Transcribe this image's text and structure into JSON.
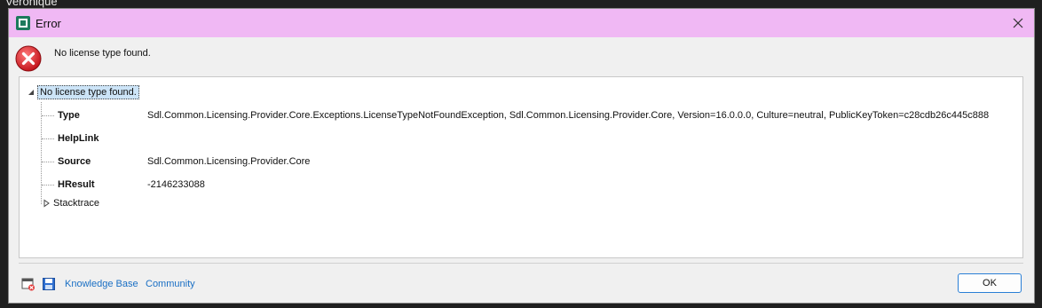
{
  "background": {
    "window_title": "Veronique"
  },
  "dialog": {
    "title": "Error",
    "titlebar_color": "#f0b8f4",
    "header_message": "No license type found.",
    "close_icon": "close-icon",
    "error_icon": "error-icon"
  },
  "tree": {
    "root_label": "No license type found.",
    "properties": [
      {
        "key": "Type",
        "value": "Sdl.Common.Licensing.Provider.Core.Exceptions.LicenseTypeNotFoundException, Sdl.Common.Licensing.Provider.Core, Version=16.0.0.0, Culture=neutral, PublicKeyToken=c28cdb26c445c888"
      },
      {
        "key": "HelpLink",
        "value": ""
      },
      {
        "key": "Source",
        "value": "Sdl.Common.Licensing.Provider.Core"
      },
      {
        "key": "HResult",
        "value": "-2146233088"
      }
    ],
    "stacktrace_label": "Stacktrace"
  },
  "footer": {
    "links": [
      "Knowledge Base",
      "Community"
    ],
    "link_color": "#1a6fc4",
    "ok_label": "OK"
  }
}
